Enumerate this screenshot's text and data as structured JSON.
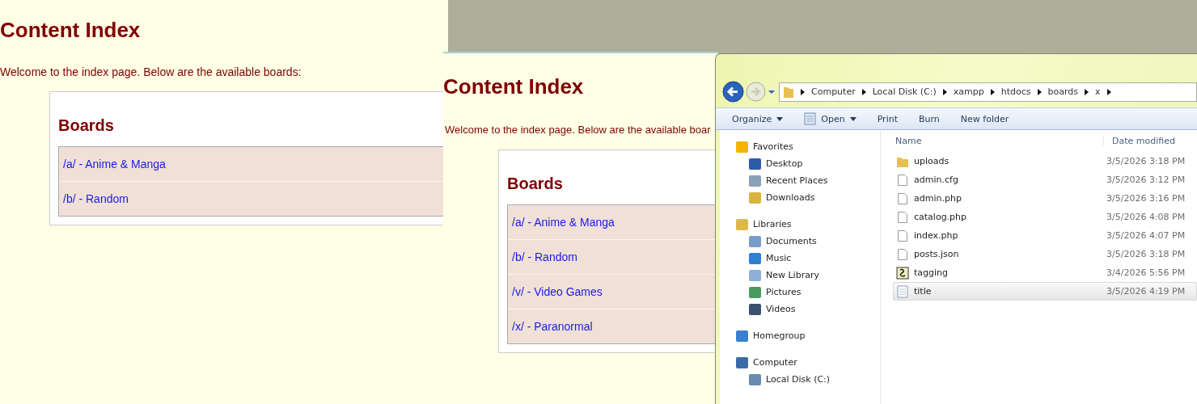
{
  "browser_pages": [
    {
      "title": "Content Index",
      "intro": "Welcome to the index page. Below are the available boards:",
      "section_title": "Boards",
      "boards": [
        {
          "label": "/a/ - Anime & Manga"
        },
        {
          "label": "/b/ - Random"
        }
      ]
    },
    {
      "title": "Content Index",
      "intro": "Welcome to the index page. Below are the available boar",
      "section_title": "Boards",
      "boards": [
        {
          "label": "/a/ - Anime & Manga"
        },
        {
          "label": "/b/ - Random"
        },
        {
          "label": "/v/ - Video Games"
        },
        {
          "label": "/x/ - Paranormal"
        }
      ]
    }
  ],
  "explorer": {
    "breadcrumbs": [
      "Computer",
      "Local Disk (C:)",
      "xampp",
      "htdocs",
      "boards",
      "x"
    ],
    "toolbar": [
      {
        "label": "Organize",
        "kind": "menu"
      },
      {
        "label": "Open",
        "kind": "open"
      },
      {
        "label": "Print",
        "kind": "plain"
      },
      {
        "label": "Burn",
        "kind": "plain"
      },
      {
        "label": "New folder",
        "kind": "plain"
      }
    ],
    "nav": [
      {
        "label": "Favorites",
        "kind": "star",
        "children": [
          {
            "label": "Desktop",
            "kind": "desktop"
          },
          {
            "label": "Recent Places",
            "kind": "recent"
          },
          {
            "label": "Downloads",
            "kind": "downloads"
          }
        ]
      },
      {
        "label": "Libraries",
        "kind": "library",
        "children": [
          {
            "label": "Documents",
            "kind": "documents"
          },
          {
            "label": "Music",
            "kind": "music"
          },
          {
            "label": "New Library",
            "kind": "newlib"
          },
          {
            "label": "Pictures",
            "kind": "pictures"
          },
          {
            "label": "Videos",
            "kind": "videos"
          }
        ]
      },
      {
        "label": "Homegroup",
        "kind": "homegroup"
      },
      {
        "label": "Computer",
        "kind": "computer",
        "children": [
          {
            "label": "Local Disk (C:)",
            "kind": "disk"
          }
        ]
      }
    ],
    "columns": [
      "Name",
      "Date modified"
    ],
    "files": [
      {
        "name": "uploads",
        "date": "3/5/2026 3:18 PM",
        "kind": "folder",
        "selected": false
      },
      {
        "name": "admin.cfg",
        "date": "3/5/2026 3:12 PM",
        "kind": "file",
        "selected": false
      },
      {
        "name": "admin.php",
        "date": "3/5/2026 3:16 PM",
        "kind": "file",
        "selected": false
      },
      {
        "name": "catalog.php",
        "date": "3/5/2026 4:08 PM",
        "kind": "file",
        "selected": false
      },
      {
        "name": "index.php",
        "date": "3/5/2026 4:07 PM",
        "kind": "file",
        "selected": false
      },
      {
        "name": "posts.json",
        "date": "3/5/2026 3:18 PM",
        "kind": "file",
        "selected": false
      },
      {
        "name": "tagging",
        "date": "3/4/2026 5:56 PM",
        "kind": "script",
        "selected": false
      },
      {
        "name": "title",
        "date": "3/5/2026 4:19 PM",
        "kind": "text",
        "selected": true
      }
    ]
  }
}
